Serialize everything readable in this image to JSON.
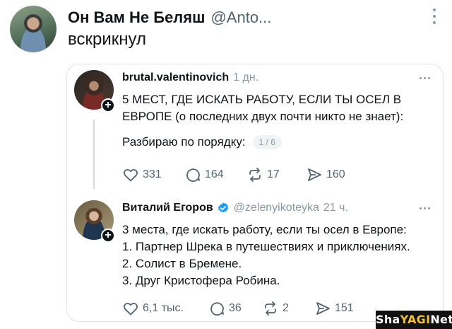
{
  "main_post": {
    "display_name": "Он Вам Не Беляш",
    "handle": "@Anto...",
    "text": "вскрикнул"
  },
  "thread_post": {
    "username": "brutal.valentinovich",
    "time": "1 дн.",
    "text": "5 МЕСТ, ГДЕ ИСКАТЬ РАБОТУ, ЕСЛИ ТЫ ОСЕЛ В ЕВРОПЕ (о последних двух почти никто не знает):",
    "intro": "Разбираю по порядку:",
    "counter": "1 / 6",
    "likes": "331",
    "replies": "164",
    "reposts": "17",
    "shares": "160"
  },
  "reply_post": {
    "display_name": "Виталий Егоров",
    "handle": "@zelenyikoteyka",
    "time": "21 ч.",
    "lines": [
      "3 места, где искать работу, если ты осел в Европе:",
      "1. Партнер Шрека в путешествиях и приключениях.",
      "2. Солист в Бремене.",
      "3. Друг Кристофера Робина."
    ],
    "likes": "6,1 тыс.",
    "replies": "36",
    "reposts": "2",
    "shares": "151"
  },
  "watermark": {
    "part1": "Sha",
    "part2": "YAGI",
    "part3": "Net"
  },
  "icons": [
    "kebab-menu-icon",
    "more-dots-icon",
    "verified-badge-icon",
    "heart-icon",
    "comment-icon",
    "repost-icon",
    "share-icon",
    "follow-plus-icon"
  ],
  "colors": {
    "verified": "#1d9bf0",
    "muted": "#536471",
    "border": "#dfe3e6"
  }
}
